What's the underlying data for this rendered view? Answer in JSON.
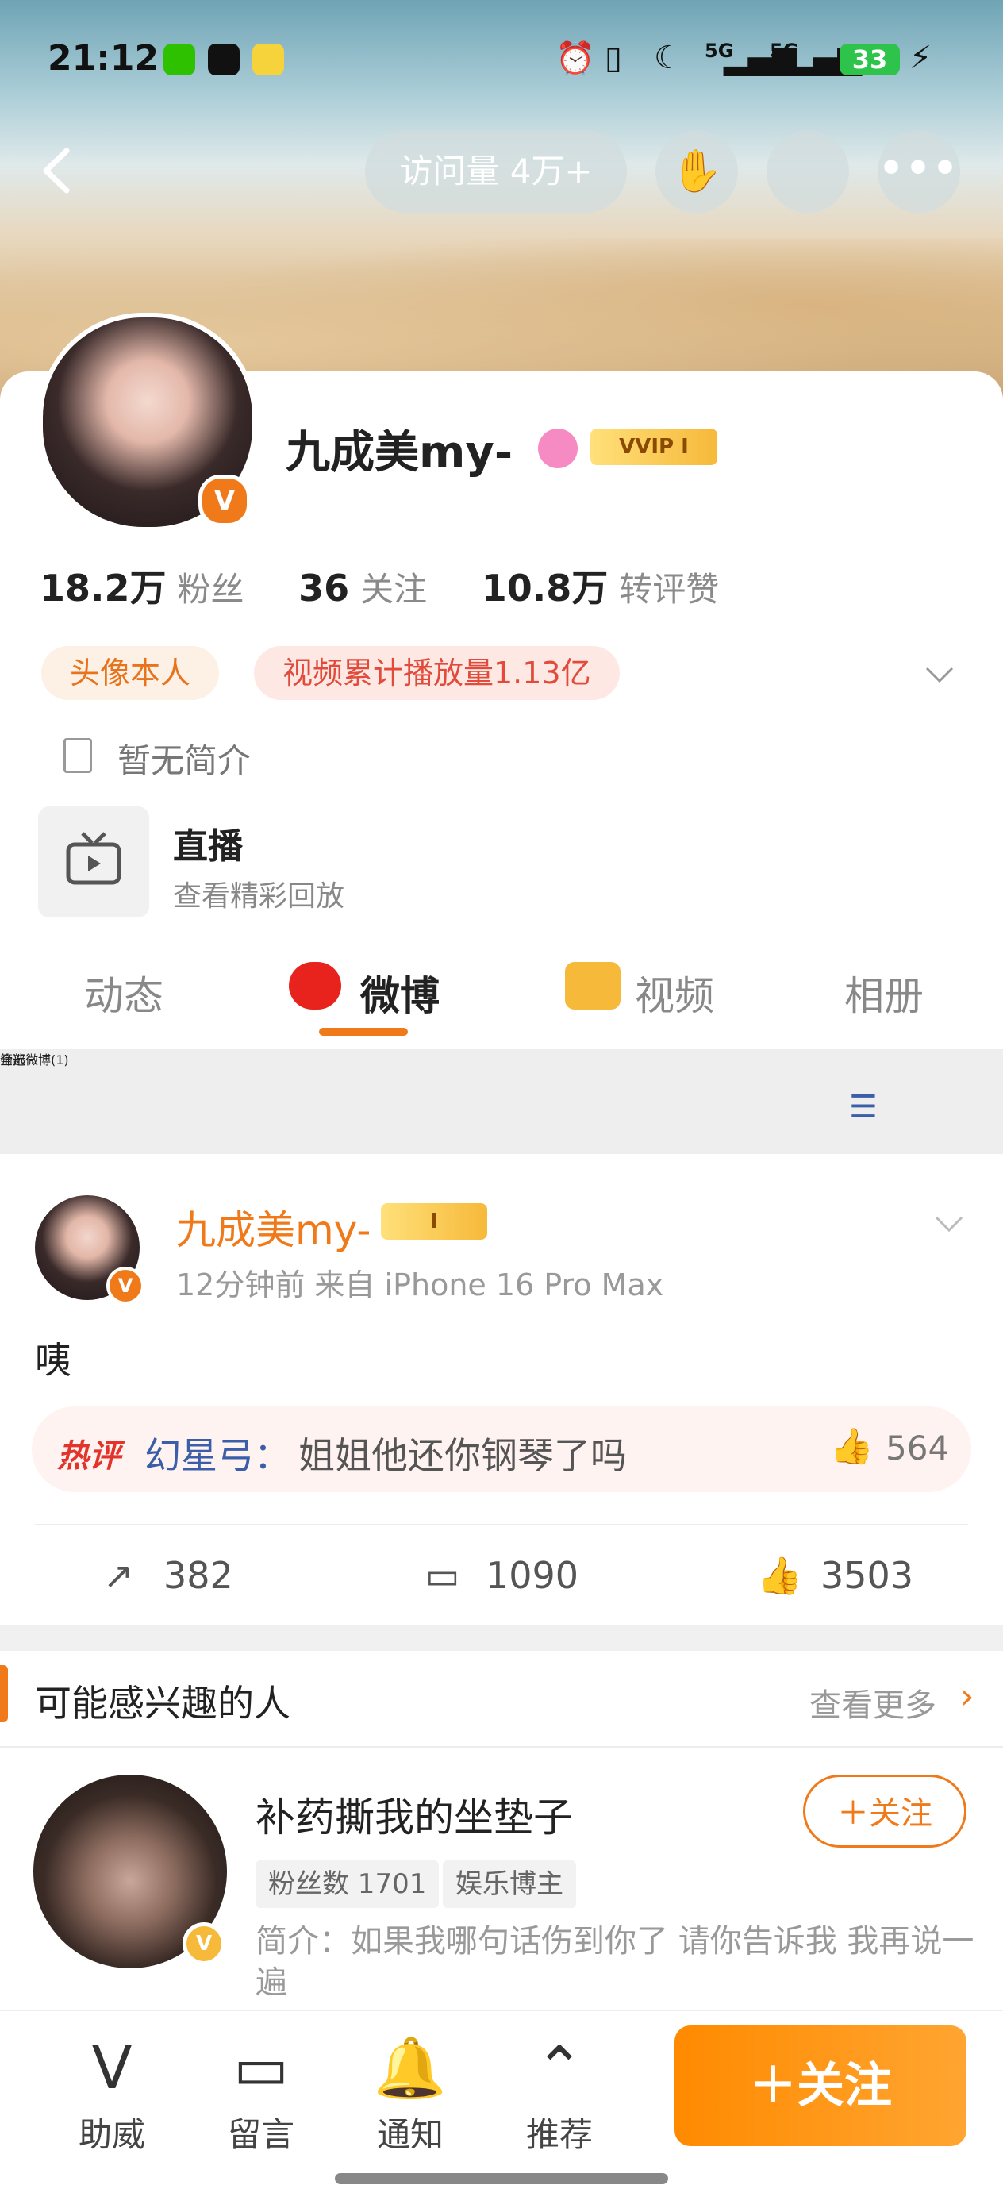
{
  "status_bar": {
    "time": "21:12",
    "network1": "5G",
    "network2": "5G",
    "battery": "33"
  },
  "header": {
    "visits": "访问量 4万+"
  },
  "profile": {
    "nickname": "九成美my-",
    "vip_label": "VVIP I",
    "stats": [
      {
        "value": "18.2万",
        "label": "粉丝"
      },
      {
        "value": "36",
        "label": "关注"
      },
      {
        "value": "10.8万",
        "label": "转评赞"
      }
    ],
    "tags": [
      "头像本人",
      "视频累计播放量1.13亿"
    ],
    "intro": "暂无简介",
    "live_title": "直播",
    "live_sub": "查看精彩回放"
  },
  "tabs": [
    "动态",
    "微博",
    "视频",
    "相册"
  ],
  "filter": {
    "left": "全部微博(1)",
    "right": "筛选"
  },
  "post": {
    "name": "九成美my-",
    "vip_label": "I",
    "meta": "12分钟前   来自 iPhone 16 Pro Max",
    "text": "咦",
    "hot_tag": "热评",
    "hot_user": "幻星弓：",
    "hot_text": "姐姐他还你钢琴了吗",
    "hot_likes": "564",
    "reposts": "382",
    "comments": "1090",
    "likes": "3503"
  },
  "recommend": {
    "title": "可能感兴趣的人",
    "more": "查看更多",
    "name": "补药撕我的坐垫子",
    "follow": "＋关注",
    "chips": [
      "粉丝数 1701",
      "娱乐博主"
    ],
    "intro": "简介：如果我哪句话伤到你了 请你告诉我 我再说一遍"
  },
  "bottom_bar": {
    "items": [
      "助威",
      "留言",
      "通知",
      "推荐"
    ],
    "follow": "＋关注"
  },
  "colors": {
    "accent": "#f07a1a",
    "link": "#3a5ea8"
  }
}
